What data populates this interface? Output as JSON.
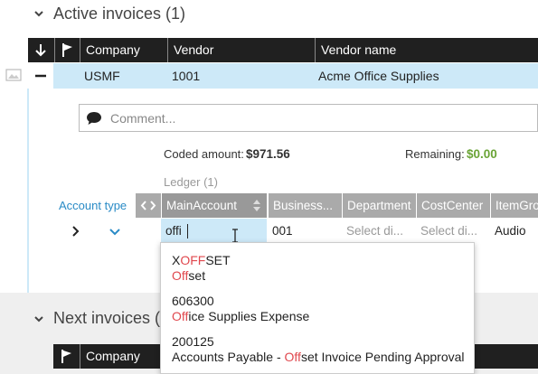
{
  "active": {
    "title": "Active invoices (1)"
  },
  "next": {
    "title": "Next invoices ("
  },
  "table": {
    "headers": {
      "company": "Company",
      "vendor": "Vendor",
      "vendor_name": "Vendor name"
    },
    "row": {
      "company": "USMF",
      "vendor": "1001",
      "vendor_name": "Acme Office Supplies"
    }
  },
  "comment": {
    "placeholder": "Comment..."
  },
  "summary": {
    "coded_label": "Coded amount:",
    "coded_value": "$971.56",
    "remaining_label": "Remaining:",
    "remaining_value": "$0.00",
    "remaining_color": "#6aa436"
  },
  "ledger": {
    "title": "Ledger (1)",
    "account_type_label": "Account type",
    "headers": [
      "MainAccount",
      "Business...",
      "Department",
      "CostCenter",
      "ItemGro"
    ],
    "row": {
      "main_account": "offi",
      "business": "001",
      "department": "Select di...",
      "cost_center": "Select di...",
      "item_group": "Audio"
    }
  },
  "dropdown": {
    "options": [
      {
        "code_pre": "X",
        "code_hl": "OFF",
        "code_post": "SET",
        "name_pre": "",
        "name_hl": "Off",
        "name_post": "set"
      },
      {
        "code_pre": "606300",
        "code_hl": "",
        "code_post": "",
        "name_pre": "",
        "name_hl": "Off",
        "name_post": "ice Supplies Expense"
      },
      {
        "code_pre": "200125",
        "code_hl": "",
        "code_post": "",
        "name_pre": "Accounts Payable - ",
        "name_hl": "Off",
        "name_post": "set Invoice Pending Approval"
      }
    ],
    "highlight_color": "#e0484e"
  },
  "colors": {
    "header_bg": "#202020",
    "selected_row": "#cde9f8",
    "accent": "#2a8bc6"
  }
}
